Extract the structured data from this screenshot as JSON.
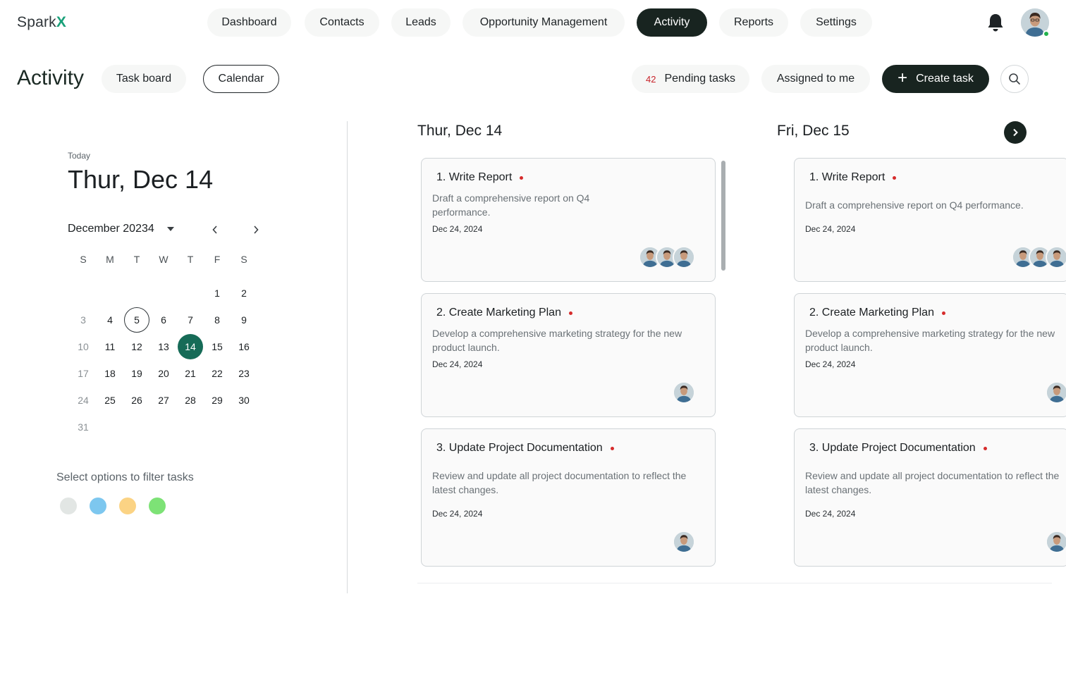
{
  "app": {
    "logo_main": "Spark",
    "logo_accent": "X",
    "accent_color": "#19a079"
  },
  "nav": {
    "items": [
      "Dashboard",
      "Contacts",
      "Leads",
      "Opportunity Management",
      "Activity",
      "Reports",
      "Settings"
    ],
    "active": "Activity",
    "icons": {
      "notifications": "bell-icon",
      "profile": "user-avatar"
    }
  },
  "subheader": {
    "title": "Activity",
    "views": [
      "Task board",
      "Calendar"
    ],
    "selected_view": "Calendar",
    "pending_count": "42",
    "pending_label": "Pending tasks",
    "assigned_label": "Assigned to me",
    "create_label": "Create task",
    "search_icon": "search-icon"
  },
  "calendar": {
    "today_label": "Today",
    "today_date": "Thur, Dec 14",
    "month_label": "December",
    "year_label": "20234",
    "weekdays": [
      "S",
      "M",
      "T",
      "W",
      "T",
      "F",
      "S"
    ],
    "days": [
      "1",
      "2",
      "3",
      "4",
      "5",
      "6",
      "7",
      "8",
      "9",
      "10",
      "11",
      "12",
      "13",
      "14",
      "15",
      "16",
      "17",
      "18",
      "19",
      "20",
      "21",
      "22",
      "23",
      "24",
      "25",
      "26",
      "27",
      "28",
      "29",
      "30",
      "31"
    ],
    "outlined_day": "5",
    "selected_day": "14",
    "selected_color": "#166b57"
  },
  "filters": {
    "label": "Select options to filter tasks",
    "colors": [
      "#e2e6e4",
      "#7dc7ef",
      "#fbd384",
      "#7de276"
    ]
  },
  "columns": [
    {
      "title": "Thur, Dec 14",
      "tasks": [
        {
          "title": "1. Write Report",
          "desc_lines": [
            "Draft a comprehensive report on Q4",
            "performance."
          ],
          "date": "Dec 24, 2024",
          "assignees": 3
        },
        {
          "title": "2. Create Marketing Plan",
          "desc_lines": [
            "Develop a comprehensive marketing strategy for the new",
            "product launch."
          ],
          "date": "Dec 24, 2024",
          "assignees": 1
        },
        {
          "title": "3. Update Project Documentation",
          "desc_lines": [
            "Review and update all project documentation to reflect the",
            "latest changes."
          ],
          "date": "Dec 24, 2024",
          "assignees": 1
        }
      ]
    },
    {
      "title": "Fri, Dec 15",
      "tasks": [
        {
          "title": "1. Write Report",
          "desc_lines": [
            "Draft a comprehensive report on Q4 performance."
          ],
          "date": "Dec 24, 2024",
          "assignees": 3
        },
        {
          "title": "2. Create Marketing Plan",
          "desc_lines": [
            "Develop a comprehensive marketing strategy for the new",
            "product launch."
          ],
          "date": "Dec 24, 2024",
          "assignees": 1
        },
        {
          "title": "3. Update Project Documentation",
          "desc_lines": [
            "Review and update all project documentation to reflect the",
            "latest changes."
          ],
          "date": "Dec 24, 2024",
          "assignees": 1
        }
      ]
    }
  ],
  "priority_color": "#d62b2b"
}
